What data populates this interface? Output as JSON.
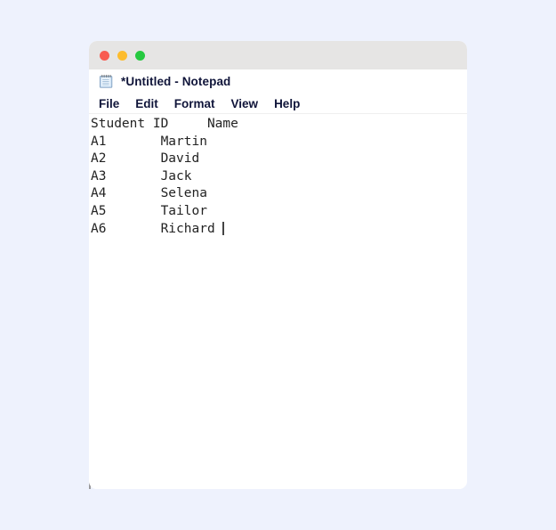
{
  "page": {
    "background_color": "#eef2fd"
  },
  "window": {
    "titlebar": {
      "background_color": "#e6e5e4",
      "controls": [
        {
          "name": "close",
          "color": "#f85b50"
        },
        {
          "name": "minimize",
          "color": "#fdbc2d"
        },
        {
          "name": "maximize",
          "color": "#26c940"
        }
      ]
    },
    "app_icon": "notepad-icon",
    "title": "*Untitled - Notepad",
    "menu": {
      "items": [
        {
          "label": "File"
        },
        {
          "label": "Edit"
        },
        {
          "label": "Format"
        },
        {
          "label": "View"
        },
        {
          "label": "Help"
        }
      ]
    },
    "editor": {
      "content": "Student ID     Name\nA1       Martin\nA2       David\nA3       Jack\nA4       Selena\nA5       Tailor\nA6       Richard ",
      "caret_visible": true,
      "text_color": "#232323",
      "rows": [
        {
          "id": "Student ID",
          "name": "Name"
        },
        {
          "id": "A1",
          "name": "Martin"
        },
        {
          "id": "A2",
          "name": "David"
        },
        {
          "id": "A3",
          "name": "Jack"
        },
        {
          "id": "A4",
          "name": "Selena"
        },
        {
          "id": "A5",
          "name": "Tailor"
        },
        {
          "id": "A6",
          "name": "Richard"
        }
      ]
    }
  }
}
